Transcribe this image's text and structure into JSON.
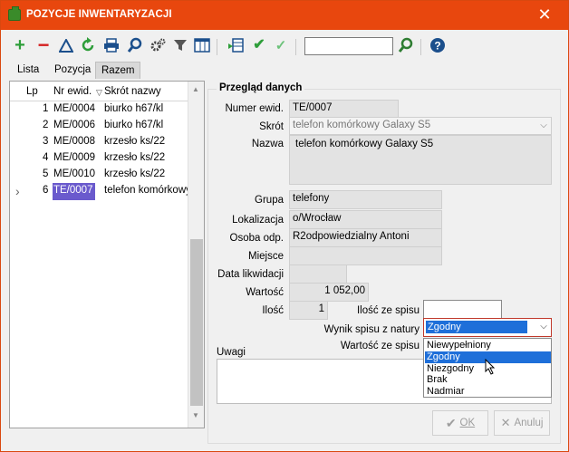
{
  "window": {
    "title": "POZYCJE INWENTARYZACJI",
    "close_glyph": "✕"
  },
  "toolbar": {
    "icons": [
      "add-icon",
      "remove-icon",
      "warning-icon",
      "refresh-icon",
      "print-icon",
      "search-icon",
      "settings-icon",
      "filter-icon",
      "columns-icon",
      "import-icon",
      "check-icon",
      "check-light-icon",
      "find-icon",
      "help-icon"
    ],
    "search_value": ""
  },
  "tabs": [
    {
      "label": "Lista",
      "active": false
    },
    {
      "label": "Pozycja",
      "active": false
    },
    {
      "label": "Razem",
      "active": true
    }
  ],
  "grid": {
    "headers": {
      "lp": "Lp",
      "nr": "Nr ewid.",
      "skrot": "Skrót nazwy"
    },
    "sort_glyph": "▽",
    "rows": [
      {
        "lp": "1",
        "nr": "ME/0004",
        "skrot": "biurko h67/kl",
        "selected": false
      },
      {
        "lp": "2",
        "nr": "ME/0006",
        "skrot": "biurko h67/kl",
        "selected": false
      },
      {
        "lp": "3",
        "nr": "ME/0008",
        "skrot": "krzesło ks/22",
        "selected": false
      },
      {
        "lp": "4",
        "nr": "ME/0009",
        "skrot": "krzesło ks/22",
        "selected": false
      },
      {
        "lp": "5",
        "nr": "ME/0010",
        "skrot": "krzesło ks/22",
        "selected": false
      },
      {
        "lp": "6",
        "nr": "TE/0007",
        "skrot": "telefon komórkowy",
        "selected": true
      }
    ]
  },
  "form": {
    "group_title": "Przegląd danych",
    "numer_label": "Numer ewid.",
    "numer_value": "TE/0007",
    "skrot_label": "Skrót",
    "skrot_value": "telefon komórkowy Galaxy S5",
    "nazwa_label": "Nazwa",
    "nazwa_value": "telefon komórkowy Galaxy S5",
    "grupa_label": "Grupa",
    "grupa_value": "telefony",
    "lokalizacja_label": "Lokalizacja",
    "lokalizacja_value": "o/Wrocław",
    "osoba_label": "Osoba odp.",
    "osoba_value": "R2odpowiedzialny Antoni",
    "miejsce_label": "Miejsce",
    "miejsce_value": "",
    "data_label": "Data likwidacji",
    "data_value": "",
    "wartosc_label": "Wartość",
    "wartosc_value": "1 052,00",
    "ilosc_label": "Ilość",
    "ilosc_value": "1",
    "ilosc_spisu_label": "Ilość ze spisu",
    "ilosc_spisu_value": "",
    "wynik_label": "Wynik spisu z natury",
    "wynik_value": "Zgodny",
    "wartosc_spisu_label": "Wartość ze spisu",
    "uwagi_label": "Uwagi",
    "uwagi_value": ""
  },
  "dropdown": {
    "options": [
      "Niewypełniony",
      "Zgodny",
      "Niezgodny",
      "Brak",
      "Nadmiar"
    ],
    "highlighted": 1
  },
  "buttons": {
    "ok_label": "OK",
    "cancel_label": "Anuluj"
  },
  "colors": {
    "title_bar": "#e8470e",
    "selection": "#1e6fd9",
    "grid_selection": "#6a5acd"
  }
}
